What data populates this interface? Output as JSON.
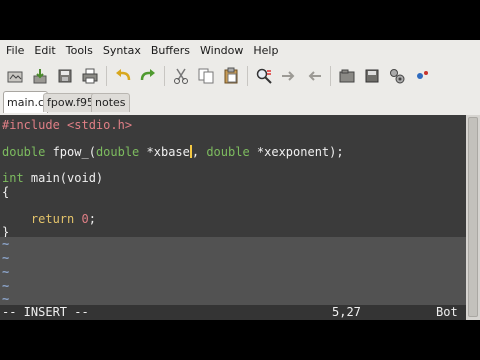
{
  "menu": [
    "File",
    "Edit",
    "Tools",
    "Syntax",
    "Buffers",
    "Window",
    "Help"
  ],
  "toolbar_icons": [
    "open-icon",
    "save-icon",
    "save-all-icon",
    "print-icon",
    "undo-icon",
    "redo-icon",
    "cut-icon",
    "copy-icon",
    "paste-icon",
    "find-replace-icon",
    "find-next-icon",
    "find-prev-icon",
    "load-session-icon",
    "save-session-icon",
    "run-script-icon",
    "make-icon"
  ],
  "tabs": [
    {
      "label": "main.c",
      "active": true
    },
    {
      "label": "fpow.f95",
      "active": false
    },
    {
      "label": "notes",
      "active": false
    }
  ],
  "code": {
    "include_kw": "#include",
    "include_file": "<stdio.h>",
    "decl_type1": "double",
    "decl_name": " fpow_(",
    "decl_type2": "double",
    "decl_arg1": " *xbase",
    "decl_sep": ", ",
    "decl_type3": "double",
    "decl_arg2": " *xexponent);",
    "main_type": "int",
    "main_sig": " main(void)",
    "open_brace": "{",
    "ret_indent": "    ",
    "ret_kw": "return",
    "ret_space": " ",
    "ret_val": "0",
    "ret_end": ";",
    "close_brace": "}",
    "tilde": "~"
  },
  "status": {
    "mode": "-- INSERT --",
    "position": "5,27",
    "percent": "Bot"
  },
  "colors": {
    "editor_bg": "#3b3b3b",
    "preprocessor": "#e07f86",
    "type": "#7dbc5f",
    "keyword": "#e3c36a",
    "number": "#e07f86",
    "cursor": "#f4c842",
    "nontext": "#8ba3c8"
  }
}
